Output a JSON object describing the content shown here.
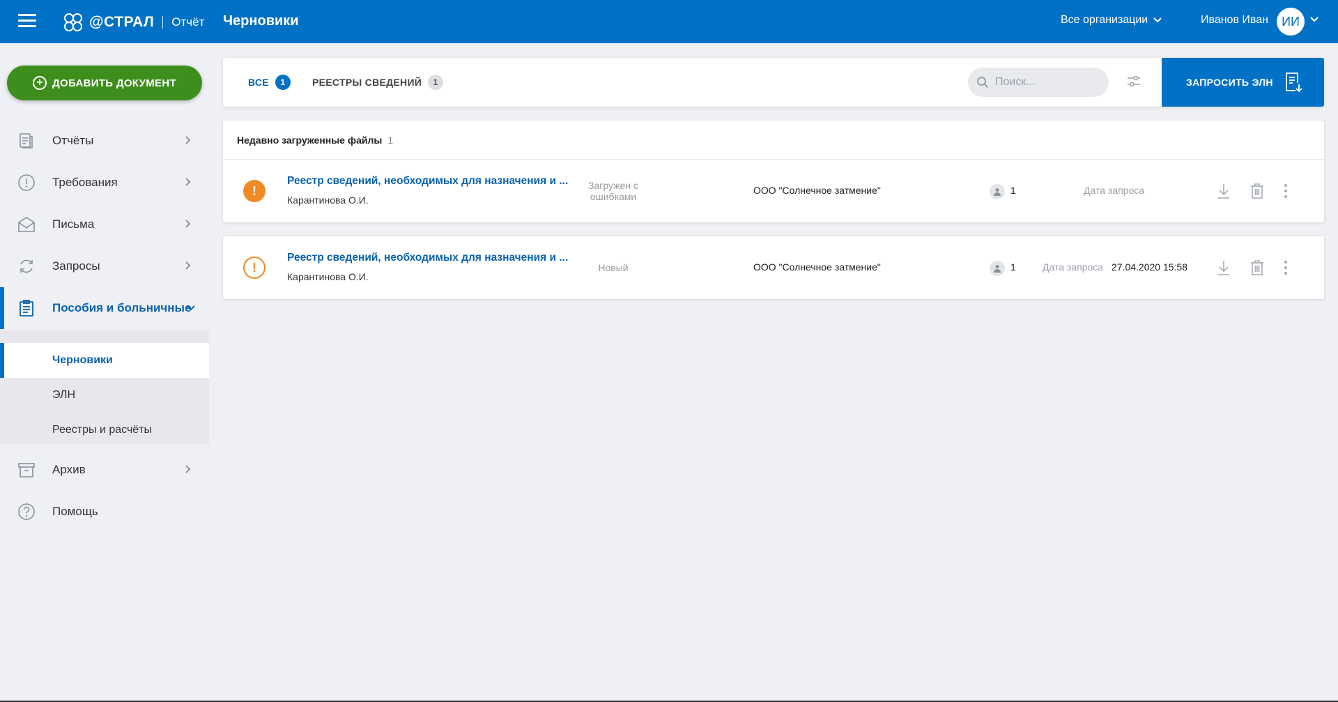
{
  "header": {
    "logo_brand": "@СТРАЛ",
    "logo_product": "Отчёт",
    "page_title": "Черновики",
    "org_select": "Все организации",
    "user_name": "Иванов Иван",
    "user_initials": "ИИ"
  },
  "sidebar": {
    "add_button": "ДОБАВИТЬ ДОКУМЕНТ",
    "items": [
      {
        "label": "Отчёты",
        "icon": "reports-icon"
      },
      {
        "label": "Требования",
        "icon": "alert-circle-icon"
      },
      {
        "label": "Письма",
        "icon": "envelope-icon"
      },
      {
        "label": "Запросы",
        "icon": "refresh-icon"
      },
      {
        "label": "Пособия и больничные",
        "icon": "clipboard-icon",
        "active": true
      },
      {
        "label": "Архив",
        "icon": "archive-icon"
      },
      {
        "label": "Помощь",
        "icon": "help-icon"
      }
    ],
    "subitems": [
      {
        "label": "Черновики",
        "active": true
      },
      {
        "label": "ЭЛН"
      },
      {
        "label": "Реестры и расчёты"
      }
    ]
  },
  "toolbar": {
    "tabs": [
      {
        "label": "ВСЕ",
        "count": "1"
      },
      {
        "label": "РЕЕСТРЫ СВЕДЕНИЙ",
        "count": "1"
      }
    ],
    "search_placeholder": "Поиск...",
    "request_button": "ЗАПРОСИТЬ ЭЛН"
  },
  "recent": {
    "heading": "Недавно загруженные файлы",
    "count": "1"
  },
  "documents": [
    {
      "title": "Реестр сведений, необходимых для назначения и ...",
      "author": "Карантинова О.И.",
      "status": "Загружен с ошибками",
      "status_icon": "error-filled-icon",
      "organization": "ООО \"Солнечное затмение\"",
      "recipients": "1",
      "date_label": "Дата запроса",
      "date_value": ""
    },
    {
      "title": "Реестр сведений, необходимых для назначения и ...",
      "author": "Карантинова О.И.",
      "status": "Новый",
      "status_icon": "warning-outline-icon",
      "organization": "ООО \"Солнечное затмение\"",
      "recipients": "1",
      "date_label": "Дата запроса",
      "date_value": "27.04.2020 15:58"
    }
  ],
  "colors": {
    "primary": "#0071c5",
    "add_button": "#3e8e1e",
    "warning": "#f08a24",
    "background": "#eef0f4"
  }
}
